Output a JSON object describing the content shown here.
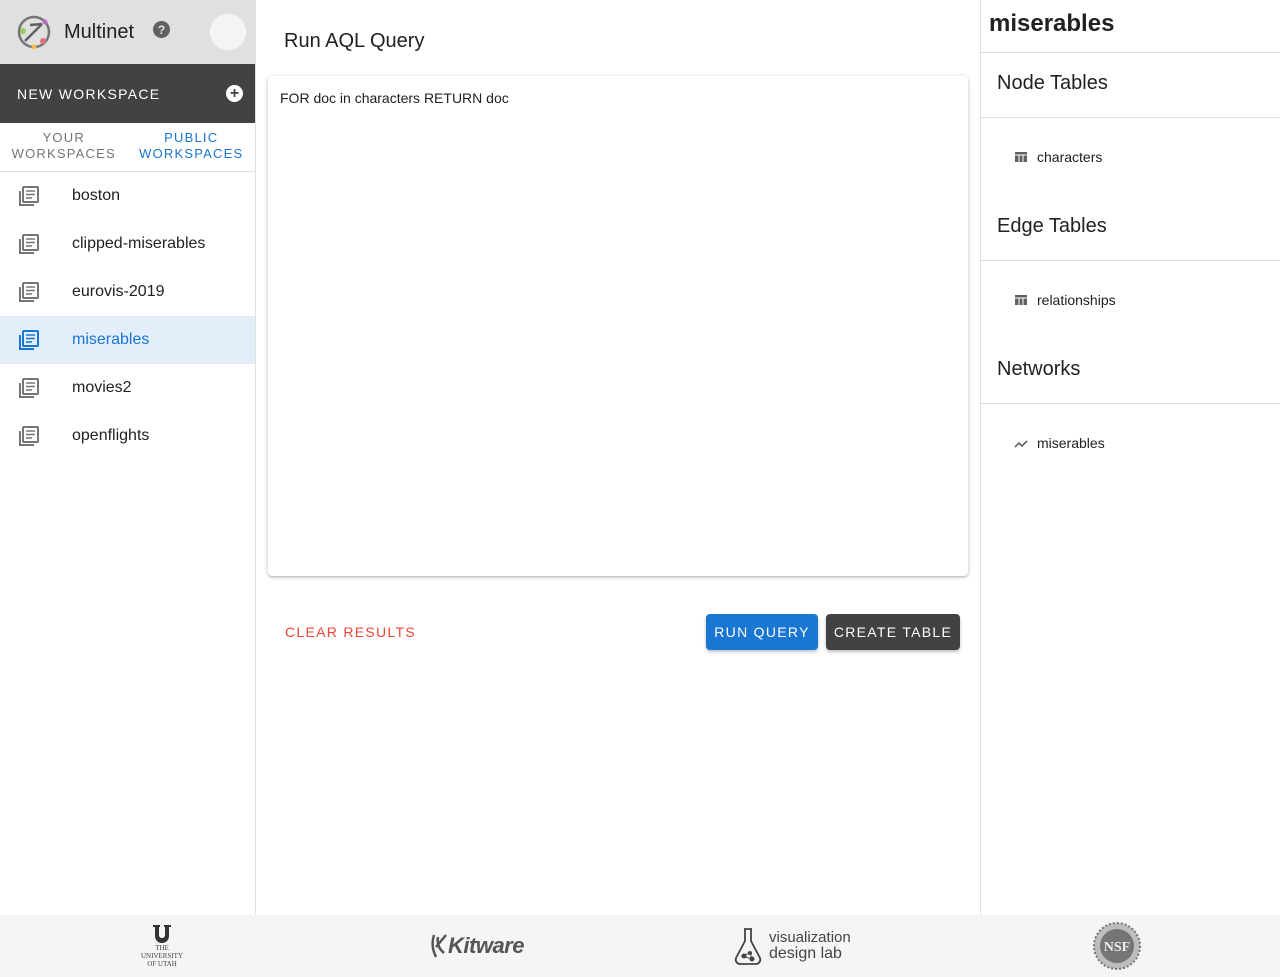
{
  "app": {
    "title": "Multinet",
    "help_glyph": "?"
  },
  "sidebar": {
    "new_workspace_label": "NEW WORKSPACE",
    "tabs": [
      {
        "label": "YOUR WORKSPACES",
        "active": false
      },
      {
        "label": "PUBLIC WORKSPACES",
        "active": true
      }
    ],
    "workspaces": [
      {
        "label": "boston",
        "active": false
      },
      {
        "label": "clipped-miserables",
        "active": false
      },
      {
        "label": "eurovis-2019",
        "active": false
      },
      {
        "label": "miserables",
        "active": true
      },
      {
        "label": "movies2",
        "active": false
      },
      {
        "label": "openflights",
        "active": false
      }
    ]
  },
  "main": {
    "title": "Run AQL Query",
    "query": "FOR doc in characters RETURN doc",
    "clear_label": "CLEAR RESULTS",
    "run_label": "RUN QUERY",
    "create_label": "CREATE TABLE"
  },
  "panel": {
    "workspace_title": "miserables",
    "node_tables_heading": "Node Tables",
    "node_tables": [
      "characters"
    ],
    "edge_tables_heading": "Edge Tables",
    "edge_tables": [
      "relationships"
    ],
    "networks_heading": "Networks",
    "networks": [
      "miserables"
    ]
  },
  "footer": {
    "uu_text": "THE UNIVERSITY OF UTAH",
    "kitware_text": "Kitware",
    "vdl_line1": "visualization",
    "vdl_line2": "design lab",
    "nsf_text": "NSF"
  },
  "colors": {
    "accent": "#1976d2",
    "dark": "#424242",
    "danger": "#f44336",
    "appbar": "#e0e0e0"
  }
}
